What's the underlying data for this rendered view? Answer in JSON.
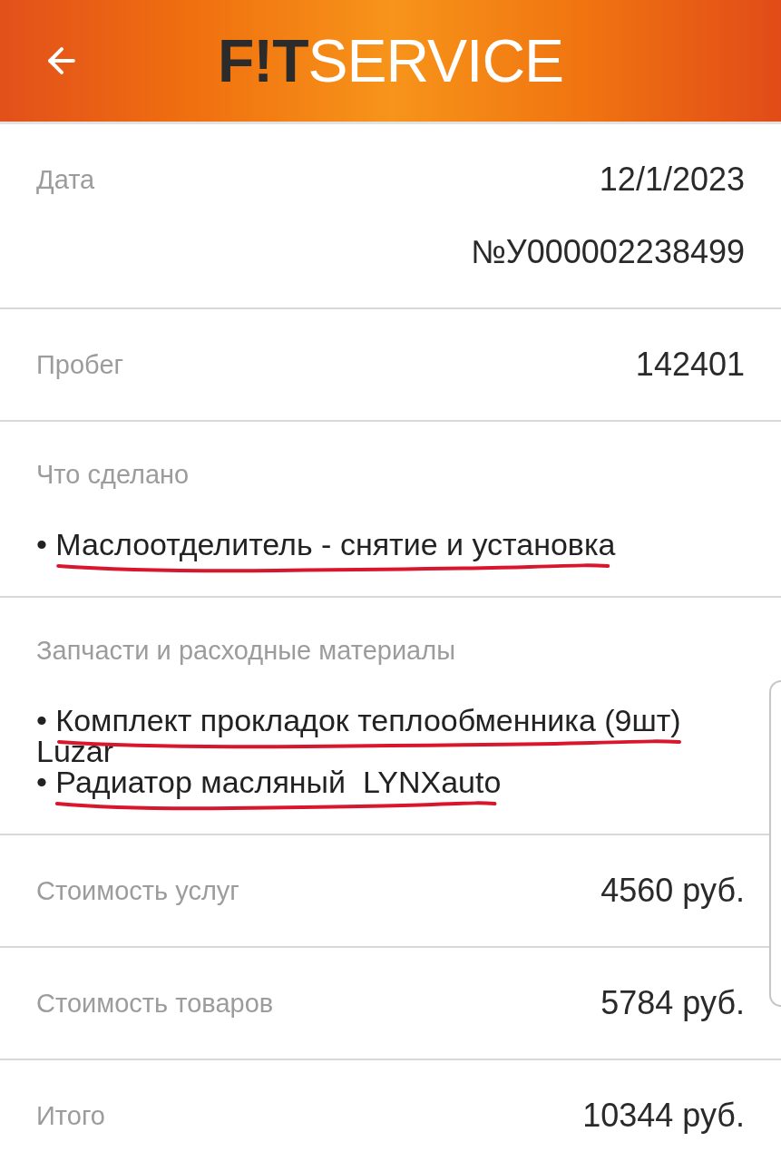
{
  "header": {
    "logo": {
      "bold_part": "F!T",
      "light_part": "SERVICE"
    }
  },
  "sections": [
    {
      "kind": "field",
      "label": "Дата",
      "values": [
        "12/1/2023",
        "№У000002238499"
      ]
    },
    {
      "kind": "field",
      "label": "Пробег",
      "values": [
        "142401"
      ]
    },
    {
      "kind": "list",
      "label": "Что сделано",
      "items": [
        {
          "text": "• Маслоотделитель - снятие и установка",
          "underlined": true
        }
      ]
    },
    {
      "kind": "list",
      "label": "Запчасти и расходные материалы",
      "items": [
        {
          "text": "• Комплект прокладок теплообменника (9шт) Luzar",
          "underlined": true
        },
        {
          "text": "• Радиатор масляный  LYNXauto",
          "underlined": true
        }
      ]
    },
    {
      "kind": "field",
      "label": "Стоимость услуг",
      "values": [
        "4560 руб."
      ]
    },
    {
      "kind": "field",
      "label": "Стоимость товаров",
      "values": [
        "5784 руб."
      ]
    },
    {
      "kind": "field",
      "label": "Итого",
      "values": [
        "10344 руб."
      ]
    }
  ]
}
